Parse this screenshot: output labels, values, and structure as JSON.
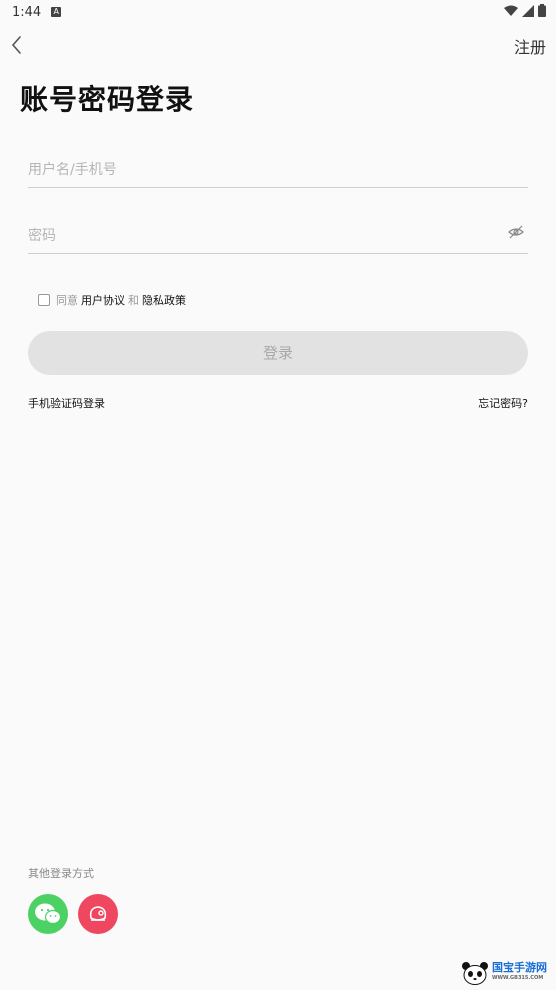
{
  "status_bar": {
    "time": "1:44",
    "notification_icon": "A"
  },
  "topbar": {
    "register_label": "注册"
  },
  "page": {
    "title": "账号密码登录"
  },
  "form": {
    "username_placeholder": "用户名/手机号",
    "password_placeholder": "密码",
    "agree_prefix": "同意",
    "user_agreement": "用户协议",
    "and": "和",
    "privacy_policy": "隐私政策",
    "login_label": "登录",
    "sms_login": "手机验证码登录",
    "forgot_password": "忘记密码?"
  },
  "other_login": {
    "title": "其他登录方式"
  },
  "watermark": {
    "name": "国宝手游网",
    "url": "WWW.GB315.COM"
  },
  "colors": {
    "wechat": "#4cd264",
    "weibo": "#ef4760",
    "button_bg": "#e2e2e2"
  }
}
